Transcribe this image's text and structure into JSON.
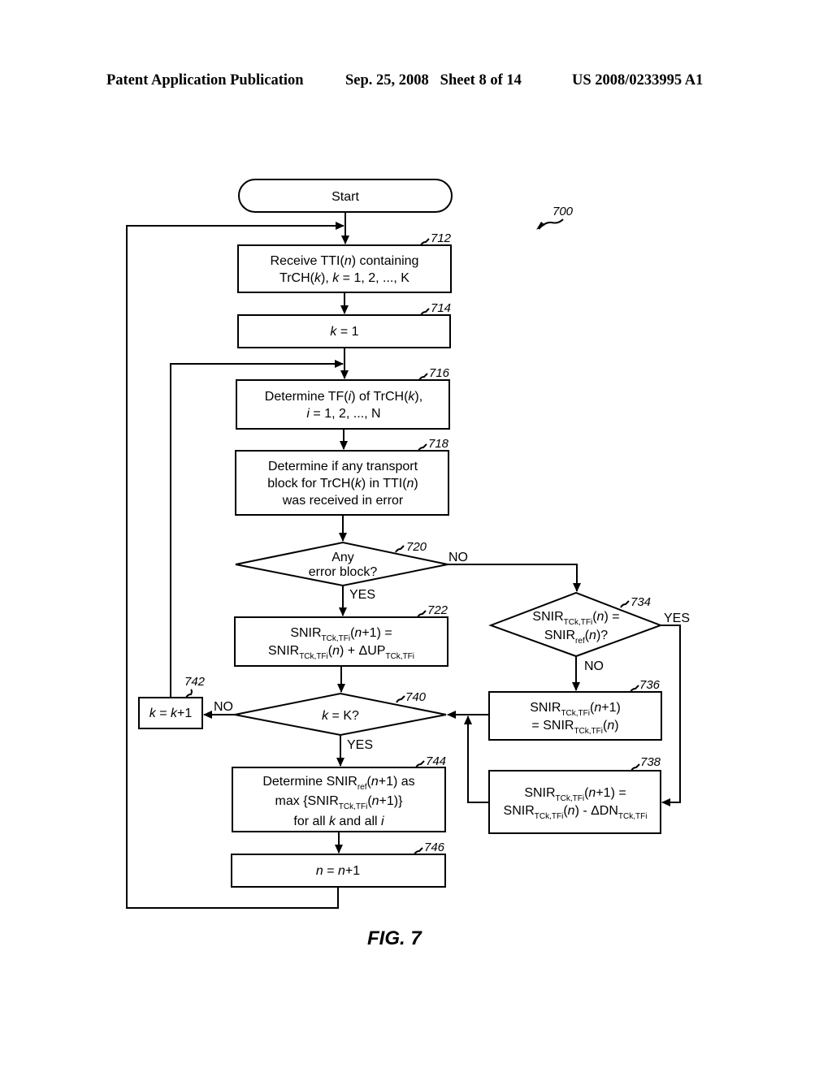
{
  "header": {
    "publication": "Patent Application Publication",
    "date_sheet": "Sep. 25, 2008   Sheet 8 of 14",
    "number": "US 2008/0233995 A1"
  },
  "diagram": {
    "ref": "700",
    "figure_label": "FIG. 7",
    "start": {
      "label": "Start"
    },
    "steps": {
      "s712": {
        "ref": "712",
        "line1": "Receive TTI(n) containing",
        "line2": "TrCH(k), k = 1, 2, ..., K"
      },
      "s714": {
        "ref": "714",
        "line1": "k = 1"
      },
      "s716": {
        "ref": "716",
        "line1": "Determine TF(i) of TrCH(k),",
        "line2": "i = 1, 2, ..., N"
      },
      "s718": {
        "ref": "718",
        "line1": "Determine if any transport",
        "line2": "block for TrCH(k) in TTI(n)",
        "line3": "was received in error"
      },
      "s720": {
        "ref": "720",
        "line1": "Any",
        "line2": "error block?",
        "yes": "YES",
        "no": "NO"
      },
      "s722": {
        "ref": "722",
        "line1": "SNIR_TCk,TFi(n+1) =",
        "line2": "SNIR_TCk,TFi(n) + ΔUP_TCk,TFi"
      },
      "s734": {
        "ref": "734",
        "line1": "SNIR_TCk,TFi(n) =",
        "line2": "SNIR_ref(n)?",
        "yes": "YES",
        "no": "NO"
      },
      "s736": {
        "ref": "736",
        "line1": "SNIR_TCk,TFi(n+1)",
        "line2": "= SNIR_TCk,TFi(n)"
      },
      "s738": {
        "ref": "738",
        "line1": "SNIR_TCk,TFi(n+1) =",
        "line2": "SNIR_TCk,TFi(n) - ΔDN_TCk,TFi"
      },
      "s740": {
        "ref": "740",
        "line1": "k = K?",
        "yes": "YES",
        "no": "NO"
      },
      "s742": {
        "ref": "742",
        "line1": "k = k+1"
      },
      "s744": {
        "ref": "744",
        "line1": "Determine SNIR_ref(n+1) as",
        "line2": "max {SNIR_TCk,TFi(n+1)}",
        "line3": "for all k and all i"
      },
      "s746": {
        "ref": "746",
        "line1": "n = n+1"
      }
    },
    "text_parts": {
      "receive_tti": "Receive TTI(",
      "containing": ") containing",
      "trch_open": "TrCH(",
      "comma_k_eq": "), ",
      "eq_1_2_K": " = 1, 2, ..., K",
      "k": "k",
      "n": "n",
      "i": "i",
      "eq_1": " = 1",
      "det_tf": "Determine TF(",
      "of_trch": ") of TrCH(",
      "close_comma": "),",
      "eq_1_2_N": " = 1, 2, ..., N",
      "det_if_any": "Determine if any transport",
      "block_for": "block for TrCH(",
      "in_tti": ") in TTI(",
      "close": ")",
      "was_received": "was received in error",
      "snir": "SNIR",
      "sub_tck": "TCk,TFi",
      "sub_ref": "ref",
      "open": "(",
      "n1_eq": "+1) =",
      "n1_close": "+1)",
      "close_eq": ") =",
      "close_q": ")?",
      "plus_dup": ") + ΔUP",
      "minus_ddn": ") - ΔDN",
      "eq_prefix": "= ",
      "eq_K_q": " = K?",
      "eq_mid": " = ",
      "plus1": "+1",
      "det_snir": "Determine ",
      "as": "+1) as",
      "max_open": "max {",
      "max_close": "+1)}",
      "for_all": "for all ",
      "and_all": " and all "
    }
  }
}
